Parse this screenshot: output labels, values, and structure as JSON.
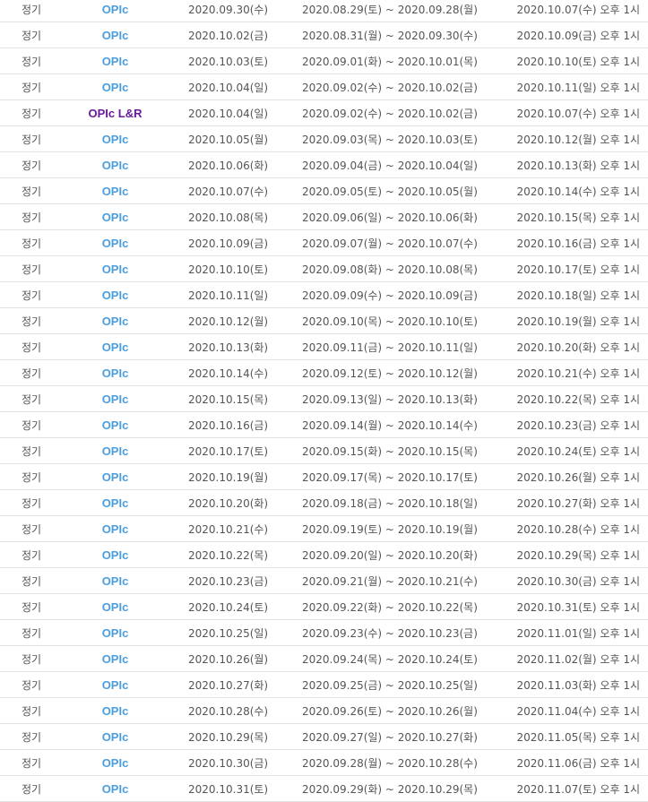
{
  "colors": {
    "opic": "#4a9ee0",
    "opic_lr": "#6a1b9a",
    "text": "#555555",
    "divider": "#e2e2e2"
  },
  "rows": [
    {
      "type": "정기",
      "exam": "OPIc",
      "exam_date": "2020.09.30(수)",
      "period": "2020.08.29(토) ~ 2020.09.28(월)",
      "result": "2020.10.07(수) 오후 1시"
    },
    {
      "type": "정기",
      "exam": "OPIc",
      "exam_date": "2020.10.02(금)",
      "period": "2020.08.31(월) ~ 2020.09.30(수)",
      "result": "2020.10.09(금) 오후 1시"
    },
    {
      "type": "정기",
      "exam": "OPIc",
      "exam_date": "2020.10.03(토)",
      "period": "2020.09.01(화) ~ 2020.10.01(목)",
      "result": "2020.10.10(토) 오후 1시"
    },
    {
      "type": "정기",
      "exam": "OPIc",
      "exam_date": "2020.10.04(일)",
      "period": "2020.09.02(수) ~ 2020.10.02(금)",
      "result": "2020.10.11(일) 오후 1시"
    },
    {
      "type": "정기",
      "exam": "OPIc L&R",
      "exam_date": "2020.10.04(일)",
      "period": "2020.09.02(수) ~ 2020.10.02(금)",
      "result": "2020.10.07(수) 오후 1시"
    },
    {
      "type": "정기",
      "exam": "OPIc",
      "exam_date": "2020.10.05(월)",
      "period": "2020.09.03(목) ~ 2020.10.03(토)",
      "result": "2020.10.12(월) 오후 1시"
    },
    {
      "type": "정기",
      "exam": "OPIc",
      "exam_date": "2020.10.06(화)",
      "period": "2020.09.04(금) ~ 2020.10.04(일)",
      "result": "2020.10.13(화) 오후 1시"
    },
    {
      "type": "정기",
      "exam": "OPIc",
      "exam_date": "2020.10.07(수)",
      "period": "2020.09.05(토) ~ 2020.10.05(월)",
      "result": "2020.10.14(수) 오후 1시"
    },
    {
      "type": "정기",
      "exam": "OPIc",
      "exam_date": "2020.10.08(목)",
      "period": "2020.09.06(일) ~ 2020.10.06(화)",
      "result": "2020.10.15(목) 오후 1시"
    },
    {
      "type": "정기",
      "exam": "OPIc",
      "exam_date": "2020.10.09(금)",
      "period": "2020.09.07(월) ~ 2020.10.07(수)",
      "result": "2020.10.16(금) 오후 1시"
    },
    {
      "type": "정기",
      "exam": "OPIc",
      "exam_date": "2020.10.10(토)",
      "period": "2020.09.08(화) ~ 2020.10.08(목)",
      "result": "2020.10.17(토) 오후 1시"
    },
    {
      "type": "정기",
      "exam": "OPIc",
      "exam_date": "2020.10.11(일)",
      "period": "2020.09.09(수) ~ 2020.10.09(금)",
      "result": "2020.10.18(일) 오후 1시"
    },
    {
      "type": "정기",
      "exam": "OPIc",
      "exam_date": "2020.10.12(월)",
      "period": "2020.09.10(목) ~ 2020.10.10(토)",
      "result": "2020.10.19(월) 오후 1시"
    },
    {
      "type": "정기",
      "exam": "OPIc",
      "exam_date": "2020.10.13(화)",
      "period": "2020.09.11(금) ~ 2020.10.11(일)",
      "result": "2020.10.20(화) 오후 1시"
    },
    {
      "type": "정기",
      "exam": "OPIc",
      "exam_date": "2020.10.14(수)",
      "period": "2020.09.12(토) ~ 2020.10.12(월)",
      "result": "2020.10.21(수) 오후 1시"
    },
    {
      "type": "정기",
      "exam": "OPIc",
      "exam_date": "2020.10.15(목)",
      "period": "2020.09.13(일) ~ 2020.10.13(화)",
      "result": "2020.10.22(목) 오후 1시"
    },
    {
      "type": "정기",
      "exam": "OPIc",
      "exam_date": "2020.10.16(금)",
      "period": "2020.09.14(월) ~ 2020.10.14(수)",
      "result": "2020.10.23(금) 오후 1시"
    },
    {
      "type": "정기",
      "exam": "OPIc",
      "exam_date": "2020.10.17(토)",
      "period": "2020.09.15(화) ~ 2020.10.15(목)",
      "result": "2020.10.24(토) 오후 1시"
    },
    {
      "type": "정기",
      "exam": "OPIc",
      "exam_date": "2020.10.19(월)",
      "period": "2020.09.17(목) ~ 2020.10.17(토)",
      "result": "2020.10.26(월) 오후 1시"
    },
    {
      "type": "정기",
      "exam": "OPIc",
      "exam_date": "2020.10.20(화)",
      "period": "2020.09.18(금) ~ 2020.10.18(일)",
      "result": "2020.10.27(화) 오후 1시"
    },
    {
      "type": "정기",
      "exam": "OPIc",
      "exam_date": "2020.10.21(수)",
      "period": "2020.09.19(토) ~ 2020.10.19(월)",
      "result": "2020.10.28(수) 오후 1시"
    },
    {
      "type": "정기",
      "exam": "OPIc",
      "exam_date": "2020.10.22(목)",
      "period": "2020.09.20(일) ~ 2020.10.20(화)",
      "result": "2020.10.29(목) 오후 1시"
    },
    {
      "type": "정기",
      "exam": "OPIc",
      "exam_date": "2020.10.23(금)",
      "period": "2020.09.21(월) ~ 2020.10.21(수)",
      "result": "2020.10.30(금) 오후 1시"
    },
    {
      "type": "정기",
      "exam": "OPIc",
      "exam_date": "2020.10.24(토)",
      "period": "2020.09.22(화) ~ 2020.10.22(목)",
      "result": "2020.10.31(토) 오후 1시"
    },
    {
      "type": "정기",
      "exam": "OPIc",
      "exam_date": "2020.10.25(일)",
      "period": "2020.09.23(수) ~ 2020.10.23(금)",
      "result": "2020.11.01(일) 오후 1시"
    },
    {
      "type": "정기",
      "exam": "OPIc",
      "exam_date": "2020.10.26(월)",
      "period": "2020.09.24(목) ~ 2020.10.24(토)",
      "result": "2020.11.02(월) 오후 1시"
    },
    {
      "type": "정기",
      "exam": "OPIc",
      "exam_date": "2020.10.27(화)",
      "period": "2020.09.25(금) ~ 2020.10.25(일)",
      "result": "2020.11.03(화) 오후 1시"
    },
    {
      "type": "정기",
      "exam": "OPIc",
      "exam_date": "2020.10.28(수)",
      "period": "2020.09.26(토) ~ 2020.10.26(월)",
      "result": "2020.11.04(수) 오후 1시"
    },
    {
      "type": "정기",
      "exam": "OPIc",
      "exam_date": "2020.10.29(목)",
      "period": "2020.09.27(일) ~ 2020.10.27(화)",
      "result": "2020.11.05(목) 오후 1시"
    },
    {
      "type": "정기",
      "exam": "OPIc",
      "exam_date": "2020.10.30(금)",
      "period": "2020.09.28(월) ~ 2020.10.28(수)",
      "result": "2020.11.06(금) 오후 1시"
    },
    {
      "type": "정기",
      "exam": "OPIc",
      "exam_date": "2020.10.31(토)",
      "period": "2020.09.29(화) ~ 2020.10.29(목)",
      "result": "2020.11.07(토) 오후 1시"
    }
  ]
}
